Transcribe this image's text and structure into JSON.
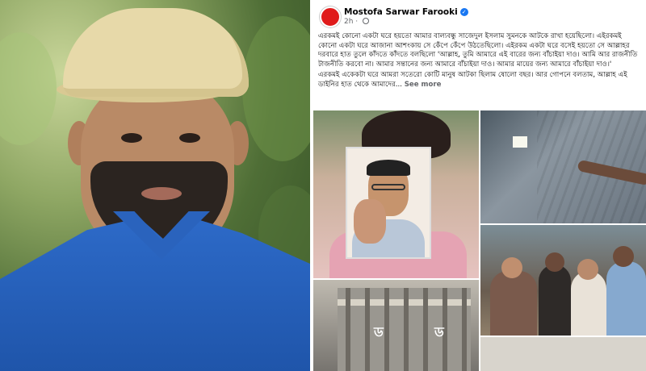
{
  "post": {
    "author": "Mostofa Sarwar Farooki",
    "time": "2h",
    "paragraph1": "এরকমই কোনো একটা ঘরে হয়তো আমার বাল্যবন্ধু সাজেদুল ইসলাম সুমনকে আটকে রাখা হয়েছিলো। এইরকমই কোনো একটা ঘরে আজানা আশংকায় সে কেঁপে কেঁপে উঠতেছিলো। এইরকম একটা ঘরে বসেই হয়তো সে আল্লাহর দরবারে হাত তুলে কাঁদতে কাঁদতে বলছিলো 'আল্লাহ, তুমি আমারে এই বারের জন্য বাঁচাইয়া দাও। আমি আর রাজনীতি টাজনীতি করবো না। আমার সন্তানের জন্য আমারে বাঁচাইয়া দাও। আমার মায়ের জন্য আমারে বাঁচাইয়া দাও।'",
    "paragraph2": "এরকমই একেকটা ঘরে আমরা সতেরো কোটি মানুষ আটকা ছিলাম ষোলো বছর। আর গোপনে বলতাম, আল্লাহ এই ডাইনির হাত থেকে আমাদের...",
    "see_more": "See more",
    "image_glyph_left": "ড",
    "image_glyph_right": "ড"
  },
  "icons": {
    "avatar": "profile-avatar-red-circle",
    "verified": "verified-badge-icon",
    "audience": "globe-icon"
  },
  "colors": {
    "verified": "#1877f2",
    "avatar": "#e01b1b",
    "secondary_text": "#65676b"
  }
}
